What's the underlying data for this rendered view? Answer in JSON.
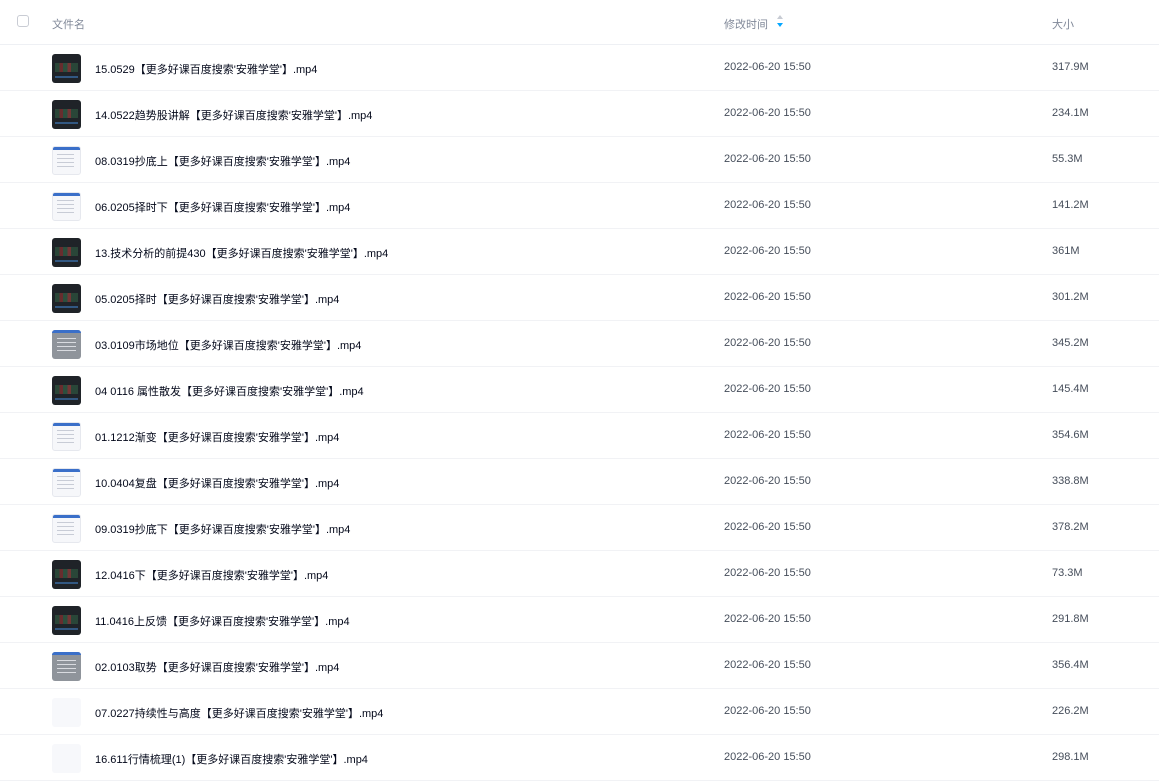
{
  "header": {
    "name_label": "文件名",
    "time_label": "修改时间",
    "size_label": "大小",
    "sort_icon": "sort-arrow-icon"
  },
  "files": [
    {
      "name": "15.0529【更多好课百度搜索'安雅学堂'】.mp4",
      "time": "2022-06-20 15:50",
      "size": "317.9M",
      "thumb": "dark"
    },
    {
      "name": "14.0522趋势股讲解【更多好课百度搜索'安雅学堂'】.mp4",
      "time": "2022-06-20 15:50",
      "size": "234.1M",
      "thumb": "dark"
    },
    {
      "name": "08.0319抄底上【更多好课百度搜索'安雅学堂'】.mp4",
      "time": "2022-06-20 15:50",
      "size": "55.3M",
      "thumb": "doc"
    },
    {
      "name": "06.0205择时下【更多好课百度搜索'安雅学堂'】.mp4",
      "time": "2022-06-20 15:50",
      "size": "141.2M",
      "thumb": "doc"
    },
    {
      "name": "13.技术分析的前提430【更多好课百度搜索'安雅学堂'】.mp4",
      "time": "2022-06-20 15:50",
      "size": "361M",
      "thumb": "dark"
    },
    {
      "name": "05.0205择时【更多好课百度搜索'安雅学堂'】.mp4",
      "time": "2022-06-20 15:50",
      "size": "301.2M",
      "thumb": "dark"
    },
    {
      "name": "03.0109市场地位【更多好课百度搜索'安雅学堂'】.mp4",
      "time": "2022-06-20 15:50",
      "size": "345.2M",
      "thumb": "gray"
    },
    {
      "name": "04 0116 属性散发【更多好课百度搜索'安雅学堂'】.mp4",
      "time": "2022-06-20 15:50",
      "size": "145.4M",
      "thumb": "dark"
    },
    {
      "name": "01.1212渐变【更多好课百度搜索'安雅学堂'】.mp4",
      "time": "2022-06-20 15:50",
      "size": "354.6M",
      "thumb": "doc"
    },
    {
      "name": "10.0404复盘【更多好课百度搜索'安雅学堂'】.mp4",
      "time": "2022-06-20 15:50",
      "size": "338.8M",
      "thumb": "doc"
    },
    {
      "name": "09.0319抄底下【更多好课百度搜索'安雅学堂'】.mp4",
      "time": "2022-06-20 15:50",
      "size": "378.2M",
      "thumb": "doc"
    },
    {
      "name": "12.0416下【更多好课百度搜索'安雅学堂'】.mp4",
      "time": "2022-06-20 15:50",
      "size": "73.3M",
      "thumb": "dark"
    },
    {
      "name": "11.0416上反馈【更多好课百度搜索'安雅学堂'】.mp4",
      "time": "2022-06-20 15:50",
      "size": "291.8M",
      "thumb": "dark"
    },
    {
      "name": "02.0103取势【更多好课百度搜索'安雅学堂'】.mp4",
      "time": "2022-06-20 15:50",
      "size": "356.4M",
      "thumb": "gray"
    },
    {
      "name": "07.0227持续性与高度【更多好课百度搜索'安雅学堂'】.mp4",
      "time": "2022-06-20 15:50",
      "size": "226.2M",
      "thumb": "blank"
    },
    {
      "name": "16.611行情梳理(1)【更多好课百度搜索'安雅学堂'】.mp4",
      "time": "2022-06-20 15:50",
      "size": "298.1M",
      "thumb": "blank"
    }
  ]
}
